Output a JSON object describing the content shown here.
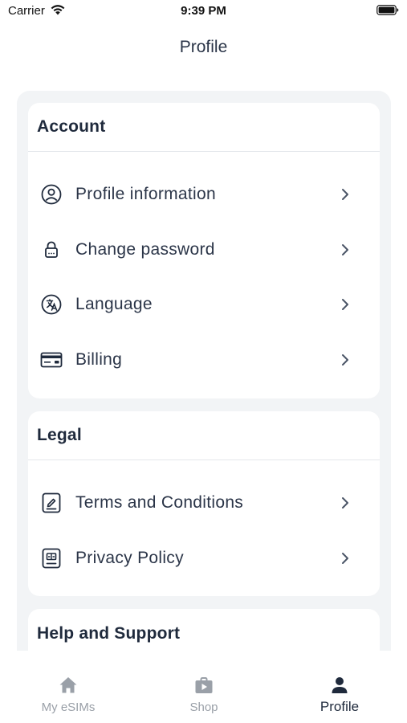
{
  "status_bar": {
    "carrier": "Carrier",
    "time": "9:39 PM"
  },
  "header": {
    "title": "Profile"
  },
  "sections": {
    "account": {
      "title": "Account",
      "items": [
        {
          "label": "Profile information",
          "icon": "user-circle-icon"
        },
        {
          "label": "Change password",
          "icon": "lock-icon"
        },
        {
          "label": "Language",
          "icon": "language-icon"
        },
        {
          "label": "Billing",
          "icon": "credit-card-icon"
        }
      ]
    },
    "legal": {
      "title": "Legal",
      "items": [
        {
          "label": "Terms and Conditions",
          "icon": "document-sign-icon"
        },
        {
          "label": "Privacy Policy",
          "icon": "scale-document-icon"
        }
      ]
    },
    "help": {
      "title": "Help and Support"
    }
  },
  "tab_bar": {
    "tabs": [
      {
        "label": "My eSIMs",
        "icon": "home-icon",
        "active": false
      },
      {
        "label": "Shop",
        "icon": "shopping-bag-icon",
        "active": false
      },
      {
        "label": "Profile",
        "icon": "person-icon",
        "active": true
      }
    ]
  },
  "colors": {
    "text": "#1f2a3c",
    "card_bg": "#ffffff",
    "panel_bg": "#f2f4f6",
    "inactive_tab": "#9aa0a8"
  }
}
